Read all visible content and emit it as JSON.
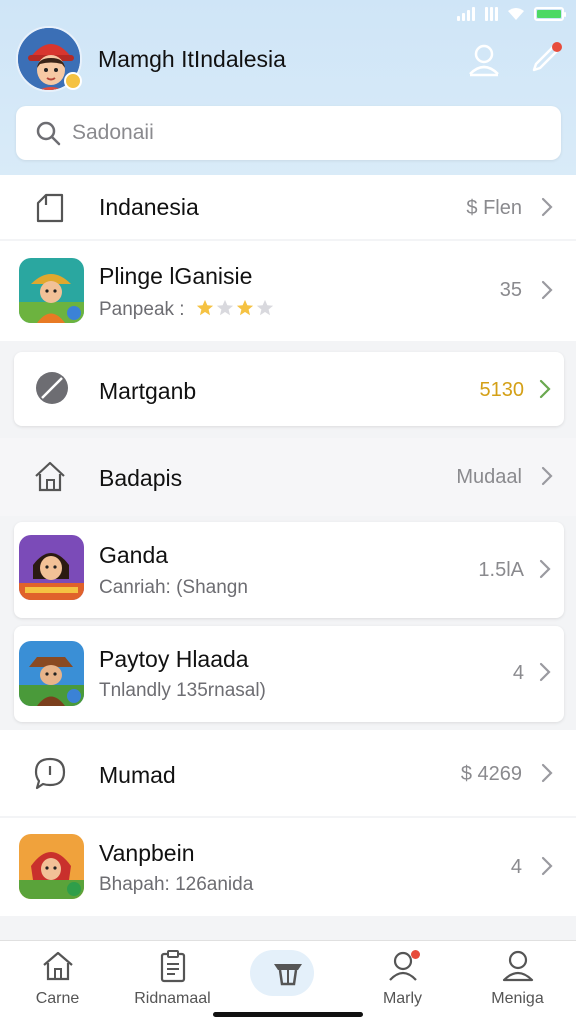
{
  "header": {
    "username": "Mamgh ItIndalesia",
    "avatar_icon": "avatar-girl-red-cap",
    "profile_icon": "person-icon",
    "edit_icon": "pencil-icon"
  },
  "search": {
    "placeholder": "Sadonaii"
  },
  "list": [
    {
      "icon": "tag-icon",
      "title": "Indanesia",
      "value": "$ Flen"
    },
    {
      "icon": "game-thumb-farmer",
      "title": "Plinge lGanisie",
      "subtitle": "Panpeak :",
      "rating": 3,
      "rating_max": 4,
      "value": "35"
    },
    {
      "icon": "leaf-icon",
      "title": "Martganb",
      "value": "5130",
      "value_color": "#d4a017"
    },
    {
      "icon": "house-icon",
      "title": "Badapis",
      "value": "Mudaal"
    },
    {
      "icon": "game-thumb-girl",
      "title": "Ganda",
      "subtitle": "Canriah: (Shangn",
      "value": "1.5lA"
    },
    {
      "icon": "game-thumb-cowboy",
      "title": "Paytoy Hlaada",
      "subtitle": "Tnlandly 135rnasal)",
      "value": "4"
    },
    {
      "icon": "chat-bubble-icon",
      "title": "Mumad",
      "value": "$ 4269"
    },
    {
      "icon": "game-thumb-redhood",
      "title": "Vanpbein",
      "subtitle": "Bhapah: 126anida",
      "value": "4"
    }
  ],
  "tabs": [
    {
      "label": "Carne",
      "icon": "home-icon"
    },
    {
      "label": "Ridnamaal",
      "icon": "clipboard-icon"
    },
    {
      "label": "",
      "icon": "hat-icon",
      "active": true
    },
    {
      "label": "Marly",
      "icon": "user-notification-icon"
    },
    {
      "label": "Meniga",
      "icon": "profile-icon"
    }
  ],
  "colors": {
    "header_bg": "#d5e8f7",
    "accent_gold": "#d4a017",
    "badge_red": "#e74c3c"
  }
}
